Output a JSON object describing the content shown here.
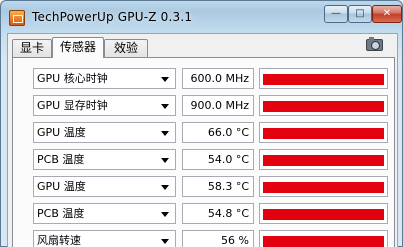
{
  "window": {
    "title": "TechPowerUp GPU-Z 0.3.1",
    "min_symbol": "—",
    "max_symbol": "□",
    "close_symbol": "✕"
  },
  "tabs": [
    {
      "label": "显卡",
      "active": false
    },
    {
      "label": "传感器",
      "active": true
    },
    {
      "label": "效验",
      "active": false
    }
  ],
  "colors": {
    "graph_bar": "#e3000f"
  },
  "sensors": [
    {
      "label": "GPU 核心时钟",
      "value": "600.0 MHz",
      "fill": 1.0
    },
    {
      "label": "GPU 显存时钟",
      "value": "900.0 MHz",
      "fill": 1.0
    },
    {
      "label": "GPU 温度",
      "value": "66.0 °C",
      "fill": 1.0
    },
    {
      "label": "PCB 温度",
      "value": "54.0 °C",
      "fill": 1.0
    },
    {
      "label": "GPU 温度",
      "value": "58.3 °C",
      "fill": 1.0
    },
    {
      "label": "PCB 温度",
      "value": "54.8 °C",
      "fill": 1.0
    },
    {
      "label": "风扇转速",
      "value": "56 %",
      "fill": 1.0
    }
  ]
}
